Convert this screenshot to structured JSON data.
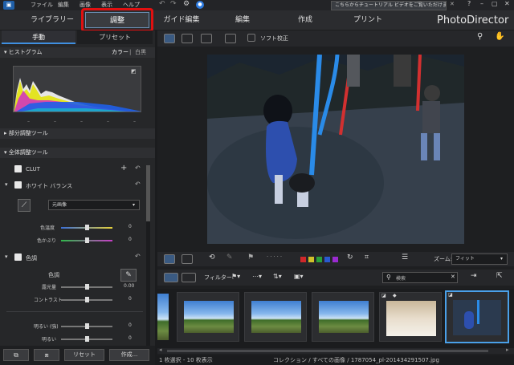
{
  "menu": {
    "file": "ファイル",
    "edit": "編集",
    "image": "画像",
    "view": "表示",
    "help": "ヘルプ"
  },
  "tutorial": "こちらからチュートリアル ビデオをご覧いただけます。",
  "tabs": {
    "library": "ライブラリー",
    "adjust": "調整",
    "guided": "ガイド編集",
    "edit": "編集",
    "create": "作成",
    "print": "プリント"
  },
  "brand": "PhotoDirector",
  "left": {
    "manual": "手動",
    "preset": "プリセット",
    "histogram": "ヒストグラム",
    "color": "カラー",
    "bw": "白黒",
    "regional": "部分調整ツール",
    "global": "全体調整ツール",
    "clut": "CLUT",
    "wb": "ホワイト バランス",
    "wb_mode": "元画像",
    "temp": "色温度",
    "temp_val": "0",
    "tint": "色かぶり",
    "tint_val": "0",
    "tone_section": "色調",
    "tone": "色調",
    "exposure": "露光量",
    "exposure_val": "0.00",
    "contrast": "コントラスト",
    "contrast_val": "0",
    "hl": "明るい (強)",
    "hl_val": "0",
    "lt": "明るい",
    "lt_val": "0",
    "reset": "リセット",
    "create": "作成..."
  },
  "toolbar": {
    "soft_proof": "ソフト校正",
    "zoom_label": "ズーム:",
    "zoom_value": "フィット"
  },
  "filmbar": {
    "filter": "フィルター:",
    "search_placeholder": "検索"
  },
  "status": {
    "selection": "1 枚選択 - 10 枚表示",
    "path": "コレクション / すべての画像 / 1787054_pl-201434291507.jpg"
  }
}
